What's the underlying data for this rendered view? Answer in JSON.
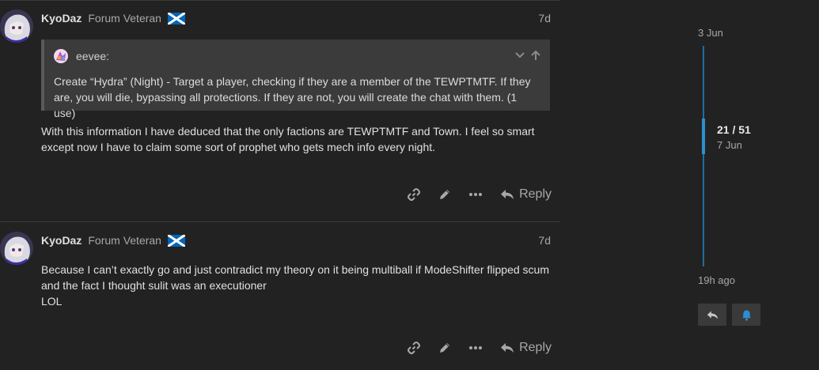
{
  "posts": [
    {
      "username": "KyoDaz",
      "user_title": "Forum Veteran",
      "date": "7d",
      "quote": {
        "username": "eevee:",
        "text": "Create “Hydra” (Night) - Target a player, checking if they are a member of the TEWPTMTF. If they are, you will die, bypassing all protections. If they are not, you will create the chat with them. (1 use)"
      },
      "body_lines": [
        "With this information I have deduced that the only factions are TEWPTMTF and Town. I feel so smart except now I have to claim some sort of prophet who gets mech info every night."
      ],
      "reply_label": "Reply"
    },
    {
      "username": "KyoDaz",
      "user_title": "Forum Veteran",
      "date": "7d",
      "body_lines": [
        "Because I can’t exactly go and just contradict my theory on it being multiball if ModeShifter flipped scum and the fact I thought sulit was an executioner",
        "LOL"
      ],
      "reply_label": "Reply"
    }
  ],
  "icons": {
    "link": "link-icon",
    "edit": "pencil-icon",
    "more": "ellipsis-icon",
    "reply": "reply-arrow-icon",
    "expand": "chevron-down-icon",
    "collapse": "arrow-up-icon",
    "notify": "bell-icon"
  },
  "timeline": {
    "start_date": "3 Jun",
    "position": "21 / 51",
    "position_date": "7 Jun",
    "end_date": "19h ago"
  },
  "colors": {
    "background": "#222222",
    "quote_bg": "#3b3b3b",
    "timeline_accent": "#2c8fd0",
    "muted_text": "#a8a8a8"
  }
}
